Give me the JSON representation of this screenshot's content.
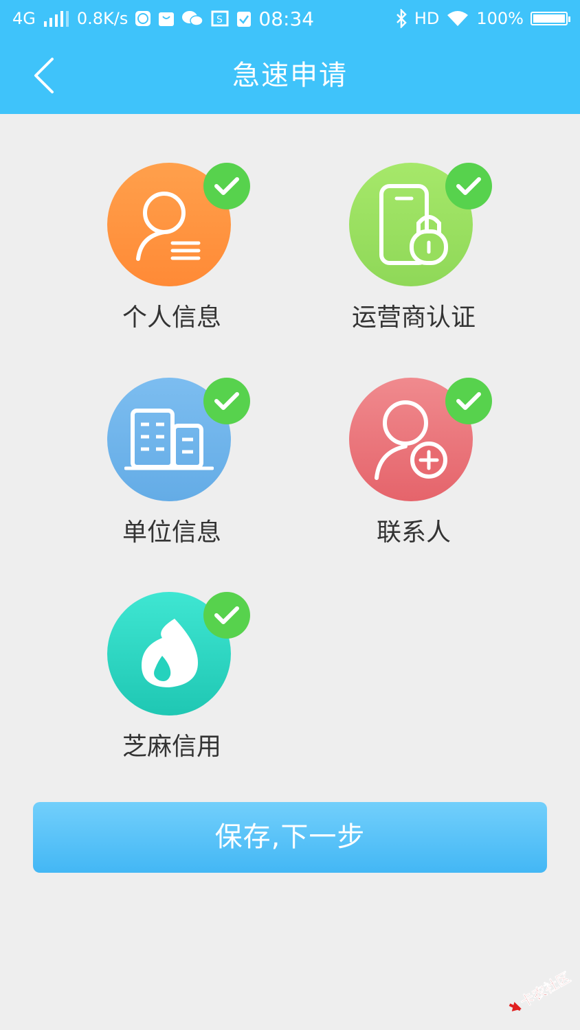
{
  "status_bar": {
    "network": "4G",
    "speed": "0.8K/s",
    "time": "08:34",
    "hd": "HD",
    "battery": "100%",
    "icons": [
      "signal-icon",
      "browser-icon",
      "shop-icon",
      "wechat-icon",
      "screenshot-icon",
      "clipboard-icon",
      "bluetooth-icon",
      "wifi-icon",
      "battery-icon"
    ]
  },
  "header": {
    "title": "急速申请",
    "back_icon": "chevron-left-icon"
  },
  "tiles": [
    {
      "label": "个人信息",
      "icon": "person-card-icon",
      "color": "#ff8f3a",
      "completed": true
    },
    {
      "label": "运营商认证",
      "icon": "phone-lock-icon",
      "color": "#97de5d",
      "completed": true
    },
    {
      "label": "单位信息",
      "icon": "building-icon",
      "color": "#6fb4ea",
      "completed": true
    },
    {
      "label": "联系人",
      "icon": "person-add-icon",
      "color": "#ea6e74",
      "completed": true
    },
    {
      "label": "芝麻信用",
      "icon": "sesame-drop-icon",
      "color": "#25d2bd",
      "completed": true
    }
  ],
  "action": {
    "save_next_label": "保存,下一步"
  },
  "watermark": {
    "text": "卡农社区"
  },
  "colors": {
    "accent": "#3fc3fa",
    "check": "#57d24d",
    "background": "#eeeeee"
  }
}
